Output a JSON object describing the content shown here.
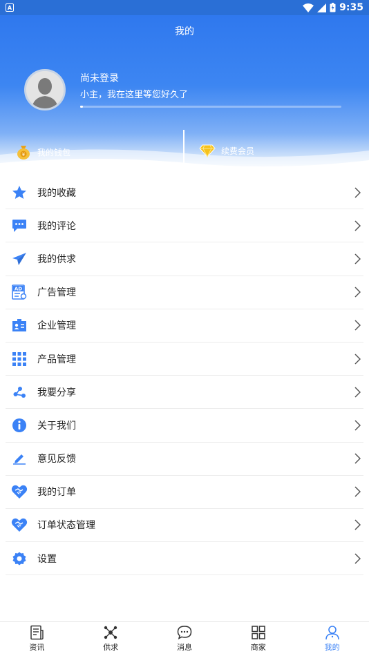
{
  "status_bar": {
    "time": "9:35"
  },
  "header": {
    "title": "我的",
    "login_title": "尚未登录",
    "login_subtitle": "小主，我在这里等您好久了",
    "progress": 0.01,
    "wallet_label": "我的钱包",
    "vip_label": "续费会员"
  },
  "menu": {
    "items": [
      {
        "label": "我的收藏",
        "icon": "star-icon"
      },
      {
        "label": "我的评论",
        "icon": "comment-icon"
      },
      {
        "label": "我的供求",
        "icon": "paper-plane-icon"
      },
      {
        "label": "广告管理",
        "icon": "ad-icon"
      },
      {
        "label": "企业管理",
        "icon": "company-icon"
      },
      {
        "label": "产品管理",
        "icon": "grid-icon"
      },
      {
        "label": "我要分享",
        "icon": "share-icon"
      },
      {
        "label": "关于我们",
        "icon": "info-icon"
      },
      {
        "label": "意见反馈",
        "icon": "edit-icon"
      },
      {
        "label": "我的订单",
        "icon": "heart-handshake-icon"
      },
      {
        "label": "订单状态管理",
        "icon": "heart-handshake-icon"
      },
      {
        "label": "设置",
        "icon": "gear-icon"
      }
    ]
  },
  "tabbar": {
    "tabs": [
      {
        "label": "资讯",
        "icon": "news-icon"
      },
      {
        "label": "供求",
        "icon": "network-icon"
      },
      {
        "label": "消息",
        "icon": "message-icon"
      },
      {
        "label": "商家",
        "icon": "store-grid-icon"
      },
      {
        "label": "我的",
        "icon": "user-icon",
        "active": true
      }
    ]
  },
  "colors": {
    "accent": "#3b82f6",
    "header_top": "#2f78ee",
    "status_bar": "#2a6fd6"
  }
}
